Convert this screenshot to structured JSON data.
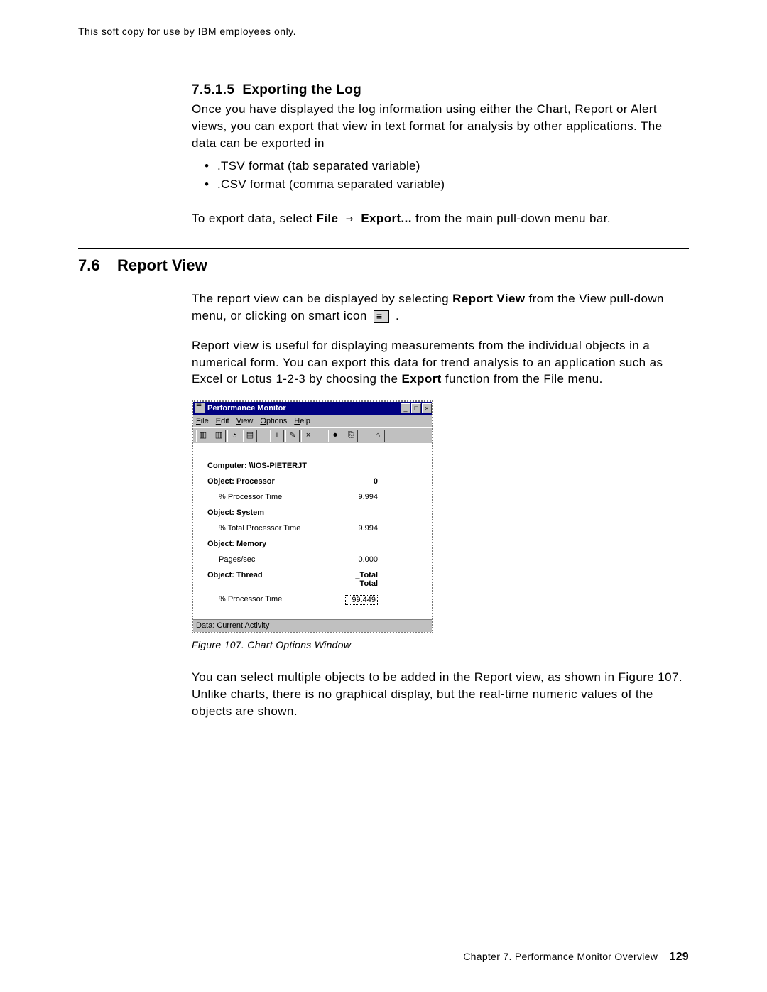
{
  "header": {
    "softcopy": "This soft copy for use by IBM employees only."
  },
  "section1": {
    "number": "7.5.1.5",
    "title": "Exporting the Log",
    "p1": "Once you have displayed the log information using either the Chart, Report or Alert views, you can export that view in text format for analysis by other applications.  The data can be exported in",
    "formats": [
      ".TSV format (tab separated variable)",
      ".CSV format (comma separated variable)"
    ],
    "export_prefix": "To export data, select ",
    "export_file": "File",
    "export_arrow": " → ",
    "export_export": "Export...",
    "export_suffix": " from the main pull-down menu bar."
  },
  "section2": {
    "number": "7.6",
    "title": "Report View",
    "p1a": "The report view can be displayed by selecting ",
    "p1b_bold": "Report View",
    "p1c": " from the View pull-down menu, or clicking on smart icon ",
    "p1d": " .",
    "p2a": "Report view is useful for displaying measurements from the individual objects in a numerical form.  You can export this data for trend analysis to an application such as Excel or Lotus 1-2-3 by choosing the ",
    "p2b_bold": "Export",
    "p2c": " function from the File menu.",
    "caption": "Figure  107.  Chart Options Window",
    "p3": "You can select multiple objects to be added in the Report view, as shown in Figure 107.  Unlike charts, there is no graphical display, but the real-time numeric values of the objects are shown."
  },
  "perfmon": {
    "title": "Performance Monitor",
    "menus": {
      "file": "File",
      "edit": "Edit",
      "view": "View",
      "options": "Options",
      "help": "Help"
    },
    "winbuttons": {
      "min": "_",
      "max": "□",
      "close": "×"
    },
    "toolbar_icons": [
      "▥",
      "▥",
      "◔",
      "▤",
      "+",
      "✎",
      "×",
      "⏺",
      "⎘",
      "⌂"
    ],
    "computer_label": "Computer: \\\\IOS-PIETERJT",
    "objects": [
      {
        "header": "Object: Processor",
        "header_val": "0",
        "rows": [
          {
            "label": "% Processor Time",
            "value": "9.994"
          }
        ]
      },
      {
        "header": "Object: System",
        "rows": [
          {
            "label": "% Total Processor Time",
            "value": "9.994"
          }
        ]
      },
      {
        "header": "Object: Memory",
        "rows": [
          {
            "label": "Pages/sec",
            "value": "0.000"
          }
        ]
      },
      {
        "header": "Object: Thread",
        "header_val": "_Total\n_Total",
        "rows": [
          {
            "label": "% Processor Time",
            "value": "99.449",
            "boxed": true
          }
        ]
      }
    ],
    "status": "Data: Current Activity"
  },
  "footer": {
    "chapter": "Chapter 7.  Performance Monitor Overview",
    "page": "129"
  }
}
